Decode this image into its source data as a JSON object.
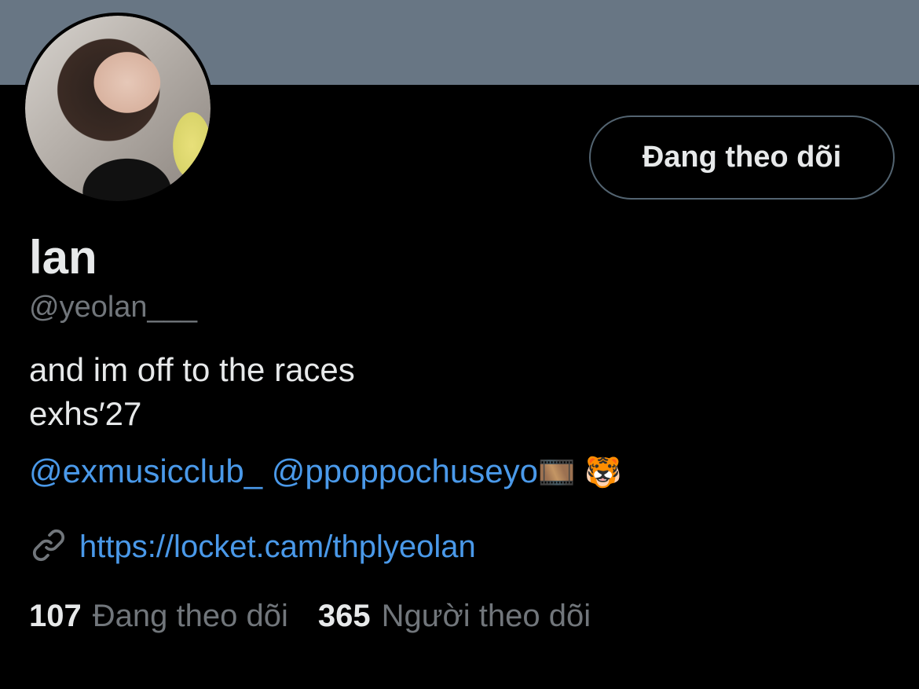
{
  "profile": {
    "display_name": "lan",
    "handle": "@yeolan___",
    "follow_button": "Đang theo dõi",
    "bio": {
      "line1": "and im off to the races",
      "line2": "exhs′27"
    },
    "mentions": {
      "first": "@exmusicclub_",
      "second": "@ppoppochuseyo",
      "emoji_1": "🎞️",
      "emoji_2": "🐯"
    },
    "link": {
      "icon": "link-icon",
      "url": "https://locket.cam/thplyeolan"
    },
    "stats": {
      "following_count": "107",
      "following_label": "Đang theo dõi",
      "followers_count": "365",
      "followers_label": "Người theo dõi"
    }
  },
  "colors": {
    "banner": "#687684",
    "background": "#000000",
    "link": "#4a99e9",
    "muted": "#71767b",
    "text": "#e7e9ea"
  }
}
